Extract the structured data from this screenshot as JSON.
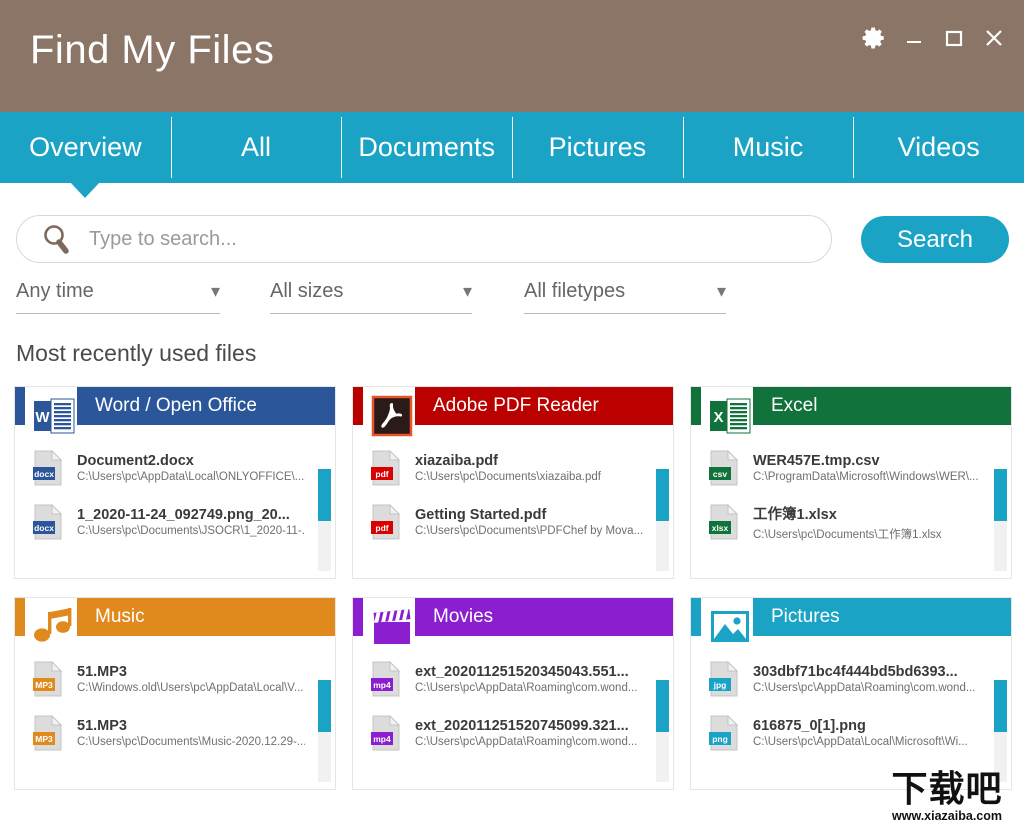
{
  "window": {
    "title": "Find My Files",
    "controls": [
      {
        "name": "settings-gear-button",
        "glyph": "gear"
      },
      {
        "name": "minimize-button",
        "glyph": "minimize"
      },
      {
        "name": "maximize-button",
        "glyph": "maximize"
      },
      {
        "name": "close-button",
        "glyph": "close"
      }
    ]
  },
  "colors": {
    "titlebar": "#8b7567",
    "accent": "#1ba3c6",
    "word": "#2b579a",
    "pdf": "#bb0000",
    "excel": "#11733b",
    "music": "#e08a1e",
    "movies": "#8b1fd0",
    "pictures": "#1ba3c6"
  },
  "tabs": [
    {
      "label": "Overview",
      "active": true
    },
    {
      "label": "All",
      "active": false
    },
    {
      "label": "Documents",
      "active": false
    },
    {
      "label": "Pictures",
      "active": false
    },
    {
      "label": "Music",
      "active": false
    },
    {
      "label": "Videos",
      "active": false
    }
  ],
  "search": {
    "placeholder": "Type to search...",
    "value": "",
    "button_label": "Search",
    "icon": "magnifier-icon"
  },
  "filters": [
    {
      "label": "Any time",
      "name": "time-filter"
    },
    {
      "label": "All sizes",
      "name": "size-filter"
    },
    {
      "label": "All filetypes",
      "name": "filetype-filter"
    }
  ],
  "section": {
    "title": "Most recently used files"
  },
  "cards": [
    {
      "title": "Word / Open Office",
      "color": "#2b579a",
      "icon": "word-icon",
      "files": [
        {
          "name": "Document2.docx",
          "path": "C:\\Users\\pc\\AppData\\Local\\ONLYOFFICE\\...",
          "ext": "docx",
          "badge": "#2b579a"
        },
        {
          "name": "1_2020-11-24_092749.png_20...",
          "path": "C:\\Users\\pc\\Documents\\JSOCR\\1_2020-11-...",
          "ext": "docx",
          "badge": "#2b579a"
        }
      ]
    },
    {
      "title": "Adobe PDF Reader",
      "color": "#bb0000",
      "icon": "acrobat-icon",
      "files": [
        {
          "name": "xiazaiba.pdf",
          "path": "C:\\Users\\pc\\Documents\\xiazaiba.pdf",
          "ext": "pdf",
          "badge": "#d80000"
        },
        {
          "name": "Getting Started.pdf",
          "path": "C:\\Users\\pc\\Documents\\PDFChef by Mova...",
          "ext": "pdf",
          "badge": "#d80000"
        }
      ]
    },
    {
      "title": "Excel",
      "color": "#11733b",
      "icon": "excel-icon",
      "files": [
        {
          "name": "WER457E.tmp.csv",
          "path": "C:\\ProgramData\\Microsoft\\Windows\\WER\\...",
          "ext": "csv",
          "badge": "#11733b"
        },
        {
          "name": "工作簿1.xlsx",
          "path": "C:\\Users\\pc\\Documents\\工作簿1.xlsx",
          "ext": "xlsx",
          "badge": "#11733b"
        }
      ]
    },
    {
      "title": "Music",
      "color": "#e08a1e",
      "icon": "music-note-icon",
      "files": [
        {
          "name": "51.MP3",
          "path": "C:\\Windows.old\\Users\\pc\\AppData\\Local\\V...",
          "ext": "MP3",
          "badge": "#e08a1e"
        },
        {
          "name": "51.MP3",
          "path": "C:\\Users\\pc\\Documents\\Music-2020.12.29-...",
          "ext": "MP3",
          "badge": "#e08a1e"
        }
      ]
    },
    {
      "title": "Movies",
      "color": "#8b1fd0",
      "icon": "clapperboard-icon",
      "files": [
        {
          "name": "ext_202011251520345043.551...",
          "path": "C:\\Users\\pc\\AppData\\Roaming\\com.wond...",
          "ext": "mp4",
          "badge": "#8b1fd0"
        },
        {
          "name": "ext_202011251520745099.321...",
          "path": "C:\\Users\\pc\\AppData\\Roaming\\com.wond...",
          "ext": "mp4",
          "badge": "#8b1fd0"
        }
      ]
    },
    {
      "title": "Pictures",
      "color": "#1ba3c6",
      "icon": "photo-icon",
      "files": [
        {
          "name": "303dbf71bc4f444bd5bd6393...",
          "path": "C:\\Users\\pc\\AppData\\Roaming\\com.wond...",
          "ext": "jpg",
          "badge": "#1ba3c6"
        },
        {
          "name": "616875_0[1].png",
          "path": "C:\\Users\\pc\\AppData\\Local\\Microsoft\\Wi...",
          "ext": "png",
          "badge": "#1ba3c6"
        }
      ]
    }
  ],
  "watermark": {
    "text": "下载吧",
    "url": "www.xiazaiba.com"
  }
}
